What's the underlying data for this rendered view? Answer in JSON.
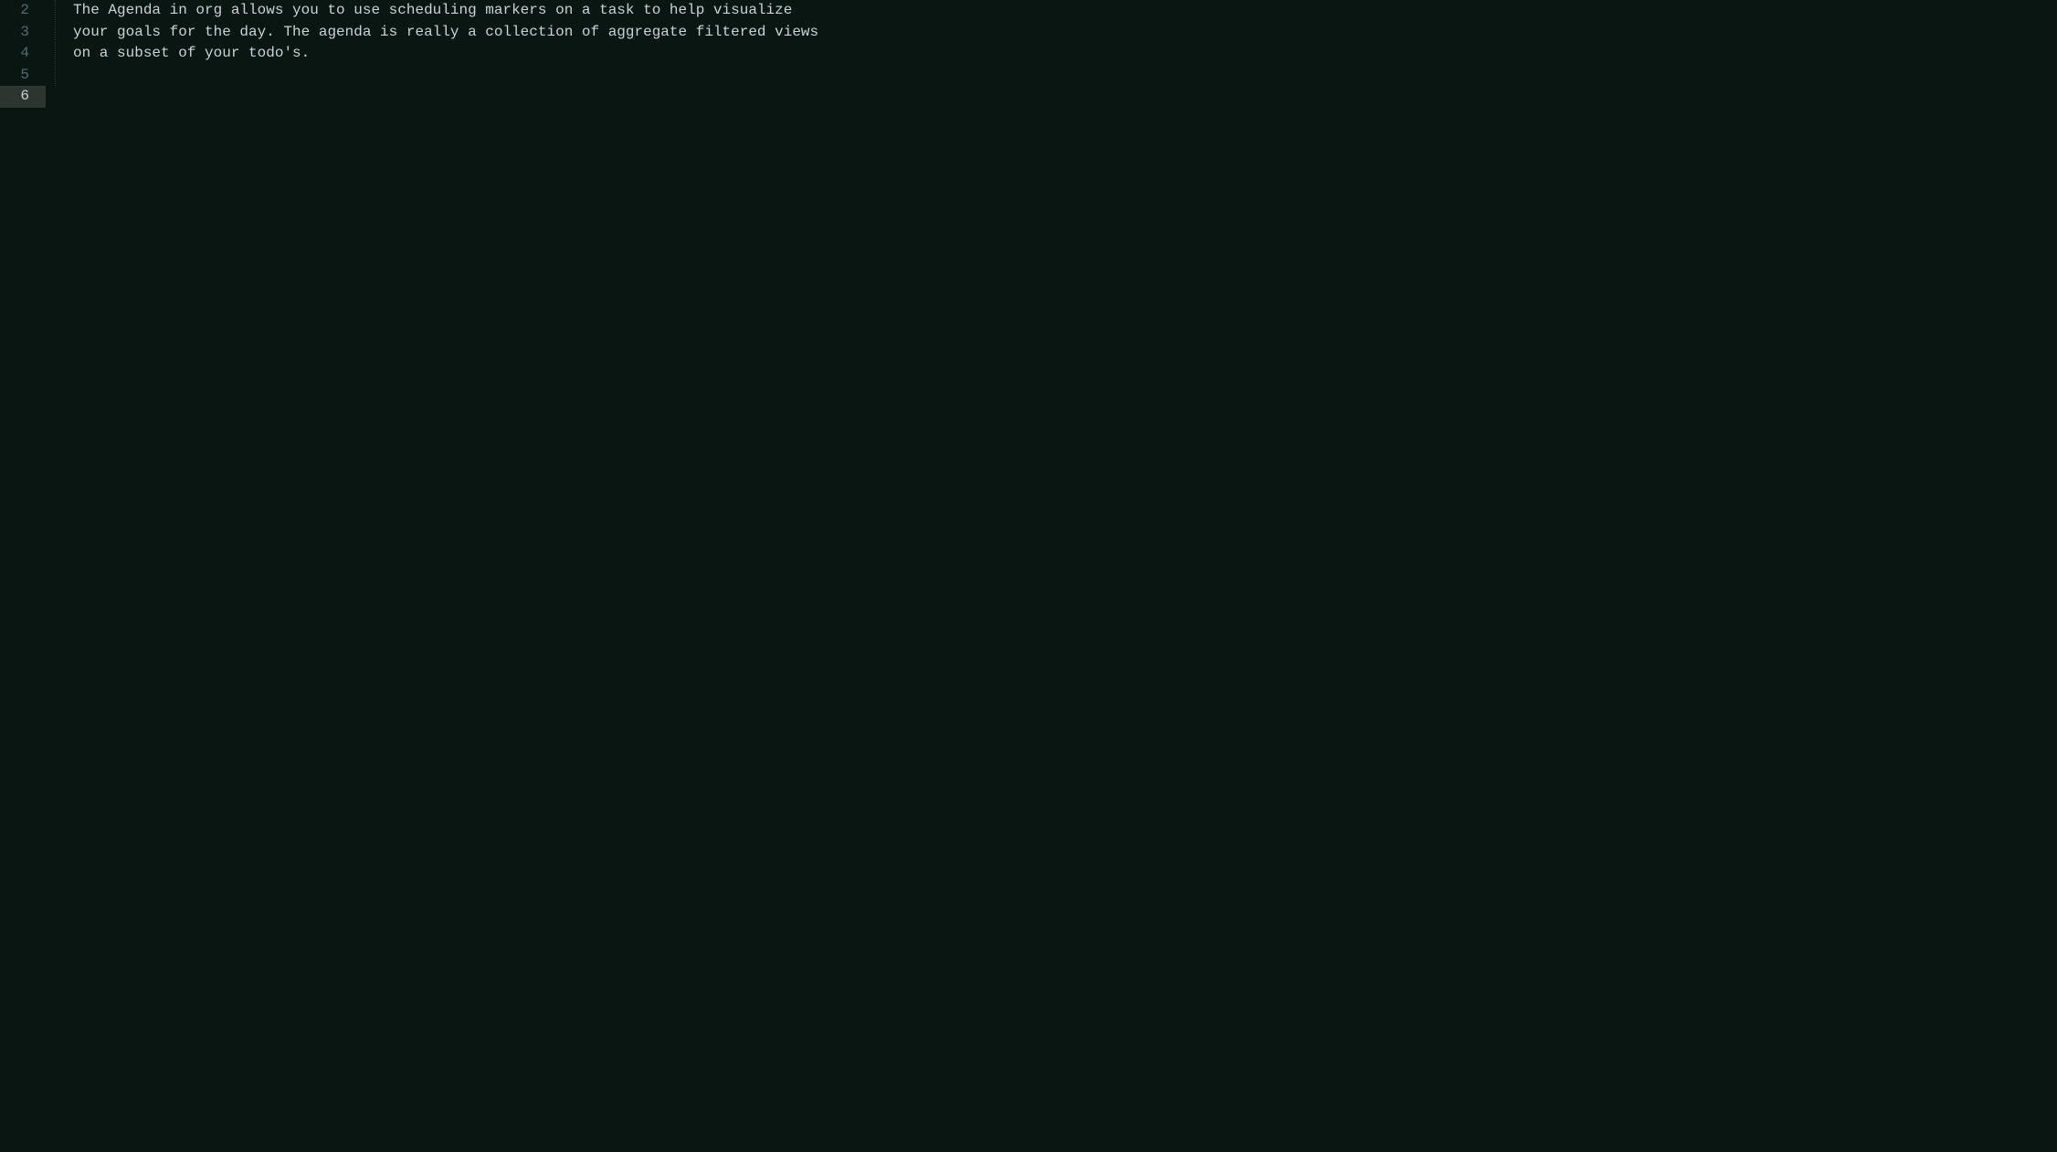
{
  "lines": [
    {
      "number": "2",
      "text": "The Agenda in org allows you to use scheduling markers on a task to help visualize",
      "current": false
    },
    {
      "number": "3",
      "text": "your goals for the day. The agenda is really a collection of aggregate filtered views",
      "current": false
    },
    {
      "number": "4",
      "text": "on a subset of your todo's.",
      "current": false
    },
    {
      "number": "5",
      "text": "",
      "current": false
    },
    {
      "number": "6",
      "text": "",
      "current": true
    }
  ]
}
